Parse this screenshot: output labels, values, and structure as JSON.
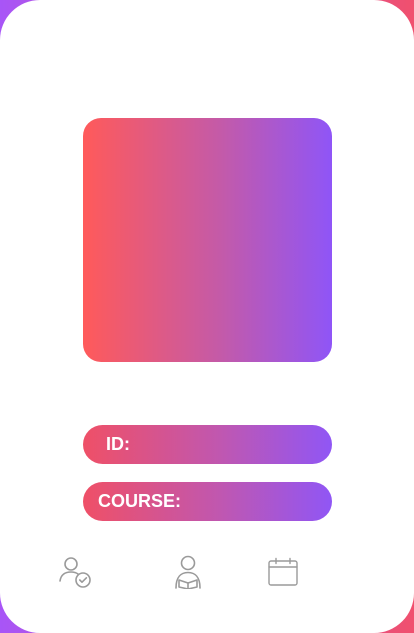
{
  "card": {
    "id_label": "ID:",
    "course_label": "COURSE:"
  },
  "photo": {
    "gradient": [
      "#ff5a5a",
      "#8f55f7"
    ]
  },
  "nav": {
    "items": [
      {
        "icon": "user-check-icon"
      },
      {
        "icon": "student-reading-icon"
      },
      {
        "icon": "calendar-icon"
      }
    ]
  },
  "colors": {
    "accent_start": "#ef5067",
    "accent_end": "#9056f5",
    "card_bg": "#ffffff",
    "icon_gray": "#9a9a9a"
  }
}
